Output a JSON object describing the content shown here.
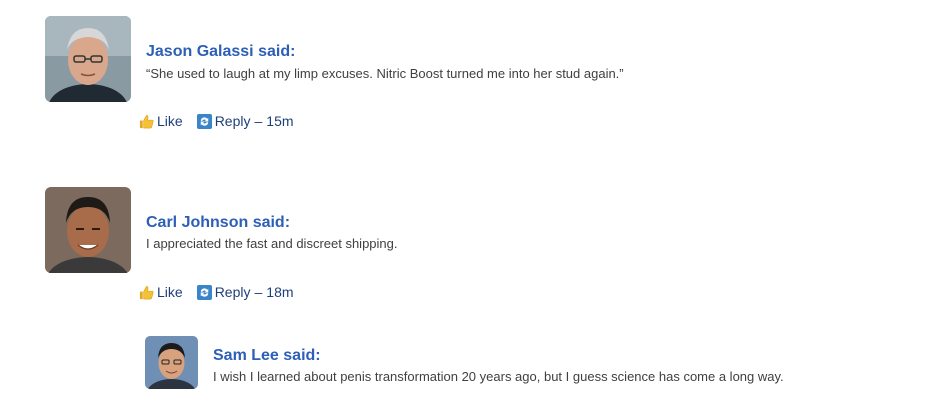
{
  "comments": [
    {
      "author": "Jason Galassi",
      "said": "said:",
      "text": "“She used to laugh at my limp excuses. Nitric Boost turned me into her stud again.”",
      "like_label": "Like",
      "reply_label": "Reply",
      "sep": "–",
      "time": "15m"
    },
    {
      "author": "Carl Johnson",
      "said": "said:",
      "text": "I appreciated the fast and discreet shipping.",
      "like_label": "Like",
      "reply_label": "Reply",
      "sep": "–",
      "time": "18m"
    },
    {
      "author": "Sam Lee",
      "said": "said:",
      "text": "I wish I learned about penis transformation 20 years ago, but I guess science has come a long way."
    }
  ],
  "icons": {
    "like": "thumbs-up-icon",
    "reply": "reply-icon"
  },
  "colors": {
    "author": "#2d5fb8",
    "action": "#1f3f7a",
    "text": "#404040"
  }
}
